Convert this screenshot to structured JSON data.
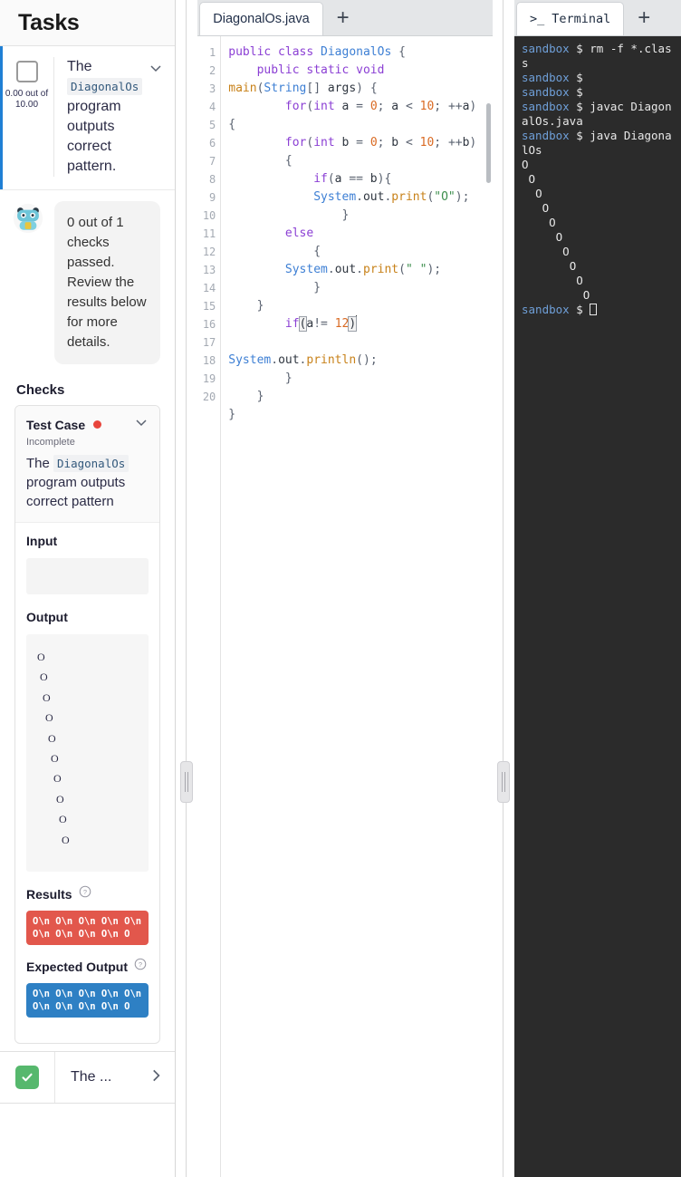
{
  "sidebar": {
    "title": "Tasks",
    "task": {
      "score": "0.00\nout of\n10.00",
      "desc_pre": "The ",
      "desc_code": "DiagonalOs",
      "desc_post": " program outputs correct pattern.",
      "checkbox_state": "unchecked"
    },
    "bot_message": "0 out of 1 checks passed. Review the results below for more details.",
    "checks_label": "Checks",
    "testcase": {
      "title": "Test Case",
      "status": "Incomplete",
      "status_color": "#e8453c",
      "desc_pre": "The ",
      "desc_code": "DiagonalOs",
      "desc_post": " program outputs correct pattern",
      "input_label": "Input",
      "input_value": "",
      "output_label": "Output",
      "output_value": "O\n O\n  O\n   O\n    O\n     O\n      O\n       O\n        O\n         O",
      "results_label": "Results",
      "results_value": "O\\n O\\n O\\n O\\n O\\n O\\n O\\n O\\n O\\n O",
      "results_color": "#e2574c",
      "expected_label": "Expected Output",
      "expected_value": "O\\n O\\n O\\n O\\n O\\n O\\n O\\n O\\n O\\n O",
      "expected_color": "#2e80c4"
    },
    "bottom": {
      "label": "The ...",
      "check_color": "#56b86d"
    }
  },
  "editor": {
    "tab_label": "DiagonalOs.java",
    "new_tab_label": "+",
    "line_numbers": "1\n2\n\n3\n4\n5\n6\n7\n8\n9\n10\n11\n12\n13\n14\n15\n16\n17\n18\n19\n20",
    "code_plain": "public class DiagonalOs {\n    public static void main(String[] args) {\n        for(int a = 0; a < 10; ++a)\n{\n        for(int b = 0; b < 10; ++b)\n        {\n            if(a == b){\n            System.out.print(\"O\");\n                }\n        else\n            {\n        System.out.print(\" \");\n            }\n    }\n        if(a!= 12)\n                System.out.println();\n        }\n    }\n}\n"
  },
  "terminal": {
    "tab_label": "Terminal",
    "tab_icon": ">_",
    "new_tab_label": "+",
    "prompt": "sandbox",
    "sigil": "$",
    "commands": [
      "rm -f *.class",
      "",
      "",
      "javac DiagonalOs.java",
      "java DiagonalOs"
    ],
    "program_output": "O\n O\n  O\n   O\n    O\n     O\n      O\n       O\n        O\n         O"
  }
}
